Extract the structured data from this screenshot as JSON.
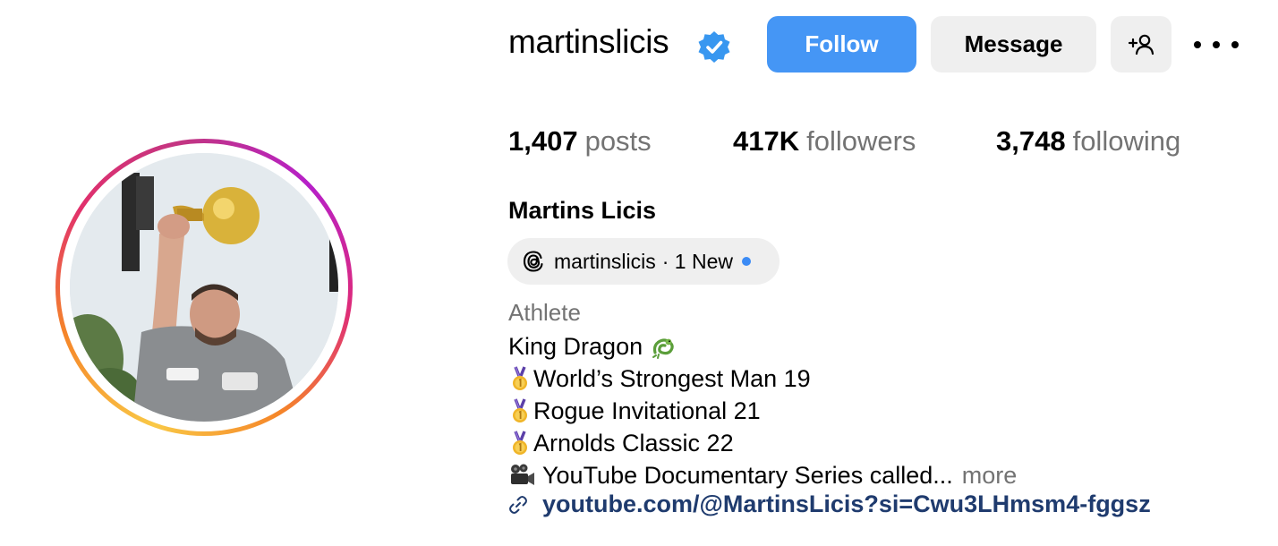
{
  "profile": {
    "username": "martinslicis",
    "full_name": "Martins Licis",
    "category": "Athlete"
  },
  "actions": {
    "follow_label": "Follow",
    "message_label": "Message"
  },
  "stats": {
    "posts_count": "1,407",
    "posts_label": "posts",
    "followers_count": "417K",
    "followers_label": "followers",
    "following_count": "3,748",
    "following_label": "following"
  },
  "threads": {
    "handle": "martinslicis",
    "badge": "· 1 New"
  },
  "bio": {
    "lines": [
      {
        "text": "King Dragon",
        "icon": "dragon-emoji"
      },
      {
        "text": "World’s Strongest Man 19",
        "icon": "gold-medal-emoji"
      },
      {
        "text": "Rogue Invitational 21",
        "icon": "gold-medal-emoji"
      },
      {
        "text": "Arnolds Classic 22",
        "icon": "gold-medal-emoji"
      },
      {
        "text": "YouTube Documentary Series called...",
        "icon": "movie-camera-emoji"
      }
    ],
    "more_label": "more"
  },
  "link": {
    "text": "youtube.com/@MartinsLicis?si=Cwu3LHmsm4-fggsz",
    "icon": "link-icon"
  },
  "colors": {
    "follow_button": "#4596f5",
    "link": "#1f3b6e",
    "secondary_text": "#737373",
    "new_dot": "#3b8bf5"
  }
}
